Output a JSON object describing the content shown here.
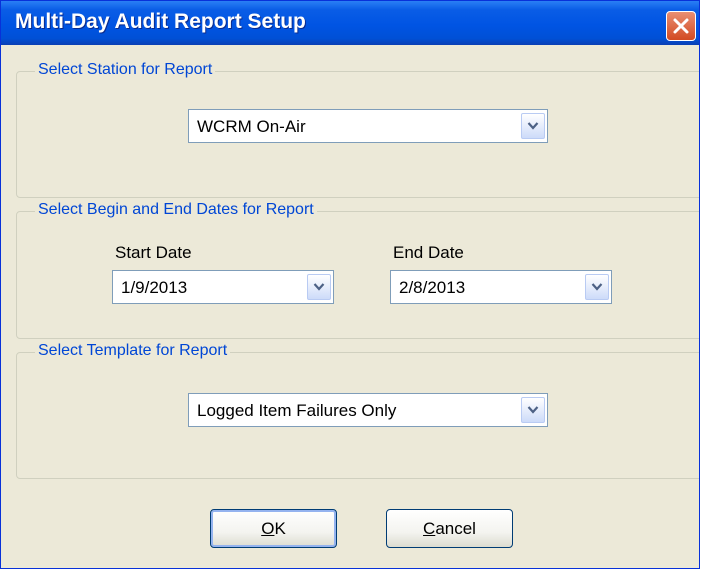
{
  "window": {
    "title": "Multi-Day Audit Report Setup"
  },
  "station_group": {
    "legend": "Select Station for Report",
    "selected_station": "WCRM On-Air"
  },
  "dates_group": {
    "legend": "Select Begin and End Dates for Report",
    "start_label": "Start Date",
    "start_value": "1/9/2013",
    "end_label": "End Date",
    "end_value": "2/8/2013"
  },
  "template_group": {
    "legend": "Select Template for Report",
    "selected_template": "Logged Item Failures Only"
  },
  "buttons": {
    "ok_mnemonic": "O",
    "ok_rest": "K",
    "cancel_mnemonic": "C",
    "cancel_rest": "ancel"
  },
  "colors": {
    "titlebar": "#0054e3",
    "window_bg": "#ece9d8",
    "legend_text": "#0046d5",
    "close_button": "#d24a22"
  },
  "icons": {
    "close": "close-icon",
    "dropdown": "chevron-down-icon"
  }
}
